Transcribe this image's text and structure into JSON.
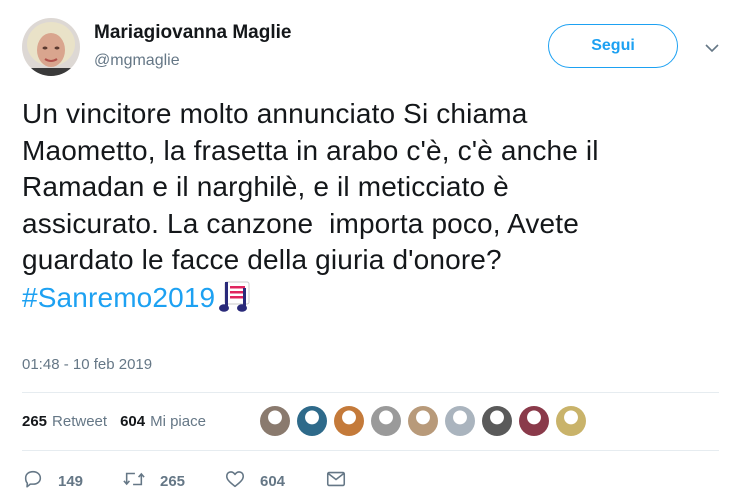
{
  "user": {
    "name": "Mariagiovanna Maglie",
    "handle": "@mgmaglie"
  },
  "follow_label": "Segui",
  "tweet": {
    "lines": [
      "Un vincitore molto annunciato Si chiama",
      "Maometto, la frasetta in arabo c'è, c'è anche il",
      "Ramadan e il narghilè, e il meticciato è",
      "assicurato. La canzone  importa poco, Avete",
      "guardato le facce della giuria d'onore?"
    ],
    "hashtag": "#Sanremo2019",
    "timestamp": "01:48 - 10 feb 2019"
  },
  "stats": {
    "retweets": "265",
    "retweets_label": "Retweet",
    "likes": "604",
    "likes_label": "Mi piace"
  },
  "liker_avatar_colors": [
    "#8a7a6e",
    "#2e6a8a",
    "#c47a3a",
    "#9a9a9a",
    "#b89a7a",
    "#aab4be",
    "#5a5a5a",
    "#8a3a4a",
    "#c9b36a"
  ],
  "actions": {
    "reply_count": "149",
    "retweet_count": "265",
    "like_count": "604"
  },
  "colors": {
    "accent": "#1da1f2",
    "secondary_text": "#657786",
    "divider": "#e6ecf0"
  },
  "icons": [
    "chevron-down-icon",
    "music-note-emoji-icon",
    "reply-icon",
    "retweet-icon",
    "heart-icon",
    "envelope-icon"
  ]
}
